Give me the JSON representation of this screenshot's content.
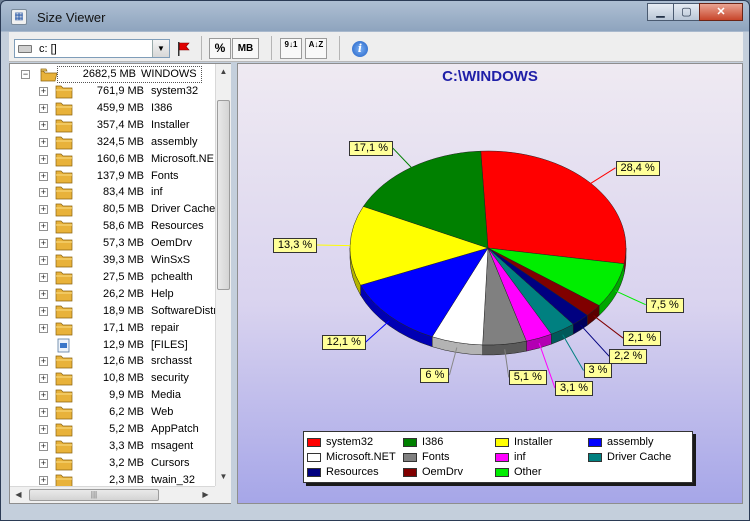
{
  "window": {
    "title": "Size Viewer",
    "icon": "app-icon"
  },
  "toolbar": {
    "drive_value": "c: []",
    "percent_label": "%",
    "mb_label": "MB",
    "sort_numeric_label": "9↓1",
    "sort_alpha_label": "A↓Z",
    "info_label": "i"
  },
  "tree": {
    "root": {
      "size": "2682,5 MB",
      "name": "WINDOWS"
    },
    "items": [
      {
        "size": "761,9 MB",
        "name": "system32"
      },
      {
        "size": "459,9 MB",
        "name": "I386"
      },
      {
        "size": "357,4 MB",
        "name": "Installer"
      },
      {
        "size": "324,5 MB",
        "name": "assembly"
      },
      {
        "size": "160,6 MB",
        "name": "Microsoft.NE"
      },
      {
        "size": "137,9 MB",
        "name": "Fonts"
      },
      {
        "size": "83,4 MB",
        "name": "inf"
      },
      {
        "size": "80,5 MB",
        "name": "Driver Cache"
      },
      {
        "size": "58,6 MB",
        "name": "Resources"
      },
      {
        "size": "57,3 MB",
        "name": "OemDrv"
      },
      {
        "size": "39,3 MB",
        "name": "WinSxS"
      },
      {
        "size": "27,5 MB",
        "name": "pchealth"
      },
      {
        "size": "26,2 MB",
        "name": "Help"
      },
      {
        "size": "18,9 MB",
        "name": "SoftwareDistri"
      },
      {
        "size": "17,1 MB",
        "name": "repair"
      },
      {
        "size": "12,9 MB",
        "name": "[FILES]",
        "is_file": true
      },
      {
        "size": "12,6 MB",
        "name": "srchasst"
      },
      {
        "size": "10,8 MB",
        "name": "security"
      },
      {
        "size": "9,9 MB",
        "name": "Media"
      },
      {
        "size": "6,2 MB",
        "name": "Web"
      },
      {
        "size": "5,2 MB",
        "name": "AppPatch"
      },
      {
        "size": "3,3 MB",
        "name": "msagent"
      },
      {
        "size": "3,2 MB",
        "name": "Cursors"
      },
      {
        "size": "2,3 MB",
        "name": "twain_32"
      }
    ]
  },
  "chart_data": {
    "type": "pie",
    "title": "C:\\WINDOWS",
    "slices": [
      {
        "name": "system32",
        "value": 28.4,
        "label": "28,4 %",
        "color": "#ff0000"
      },
      {
        "name": "Other",
        "value": 7.5,
        "label": "7,5 %",
        "color": "#00ee00"
      },
      {
        "name": "OemDrv",
        "value": 2.1,
        "label": "2,1 %",
        "color": "#800000"
      },
      {
        "name": "Resources",
        "value": 2.2,
        "label": "2,2 %",
        "color": "#000080"
      },
      {
        "name": "Driver Cache",
        "value": 3.0,
        "label": "3 %",
        "color": "#008080"
      },
      {
        "name": "inf",
        "value": 3.1,
        "label": "3,1 %",
        "color": "#ff00ff"
      },
      {
        "name": "Fonts",
        "value": 5.1,
        "label": "5,1 %",
        "color": "#808080"
      },
      {
        "name": "Microsoft.NET",
        "value": 6.0,
        "label": "6 %",
        "color": "#ffffff"
      },
      {
        "name": "assembly",
        "value": 12.1,
        "label": "12,1 %",
        "color": "#0000ff"
      },
      {
        "name": "Installer",
        "value": 13.3,
        "label": "13,3 %",
        "color": "#ffff00"
      },
      {
        "name": "I386",
        "value": 17.1,
        "label": "17,1 %",
        "color": "#008000"
      }
    ],
    "legend": [
      {
        "name": "system32",
        "color": "#ff0000"
      },
      {
        "name": "I386",
        "color": "#008000"
      },
      {
        "name": "Installer",
        "color": "#ffff00"
      },
      {
        "name": "assembly",
        "color": "#0000ff"
      },
      {
        "name": "Microsoft.NET",
        "color": "#ffffff"
      },
      {
        "name": "Fonts",
        "color": "#808080"
      },
      {
        "name": "inf",
        "color": "#ff00ff"
      },
      {
        "name": "Driver Cache",
        "color": "#008080"
      },
      {
        "name": "Resources",
        "color": "#000080"
      },
      {
        "name": "OemDrv",
        "color": "#800000"
      },
      {
        "name": "Other",
        "color": "#00ee00"
      }
    ],
    "legend_placement": "bottom"
  }
}
